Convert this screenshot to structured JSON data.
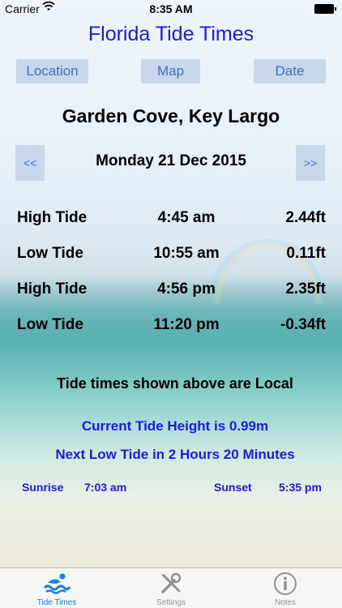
{
  "status_bar": {
    "carrier": "Carrier",
    "time": "8:35 AM"
  },
  "app_title": "Florida Tide Times",
  "top_buttons": {
    "location": "Location",
    "map": "Map",
    "date": "Date"
  },
  "location_name": "Garden Cove, Key Largo",
  "date_nav": {
    "prev": "<<",
    "date": "Monday 21 Dec 2015",
    "next": ">>"
  },
  "tides": [
    {
      "type": "High Tide",
      "time": "4:45 am",
      "height": "2.44ft"
    },
    {
      "type": "Low Tide",
      "time": "10:55 am",
      "height": "0.11ft"
    },
    {
      "type": "High Tide",
      "time": "4:56 pm",
      "height": "2.35ft"
    },
    {
      "type": "Low Tide",
      "time": "11:20 pm",
      "height": "-0.34ft"
    }
  ],
  "local_note": "Tide times shown above are Local",
  "current_height": "Current Tide Height is 0.99m",
  "next_tide": "Next Low Tide in 2 Hours 20 Minutes",
  "sun": {
    "sunrise_label": "Sunrise",
    "sunrise_time": "7:03 am",
    "sunset_label": "Sunset",
    "sunset_time": "5:35 pm"
  },
  "tab_bar": {
    "tide_times": "Tide Times",
    "settings": "Settings",
    "notes": "Notes",
    "active_color": "#1a7de0",
    "inactive_color": "#929292"
  }
}
